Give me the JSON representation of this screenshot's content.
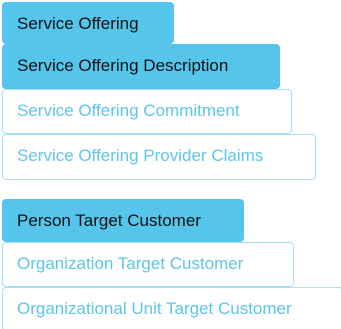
{
  "group1": {
    "items": [
      {
        "label": "Service Offering",
        "state": "active"
      },
      {
        "label": "Service Offering Description",
        "state": "active"
      },
      {
        "label": "Service Offering Commitment",
        "state": "inactive"
      },
      {
        "label": "Service Offering Provider Claims",
        "state": "inactive"
      }
    ]
  },
  "group2": {
    "items": [
      {
        "label": "Person Target Customer",
        "state": "active"
      },
      {
        "label": "Organization Target Customer",
        "state": "inactive"
      },
      {
        "label": "Organizational Unit Target Customer",
        "state": "inactive"
      }
    ]
  },
  "colors": {
    "active_bg": "#56c5eb",
    "active_text": "#111111",
    "inactive_text": "#5ec5ea",
    "inactive_border": "#a8e0f3"
  }
}
